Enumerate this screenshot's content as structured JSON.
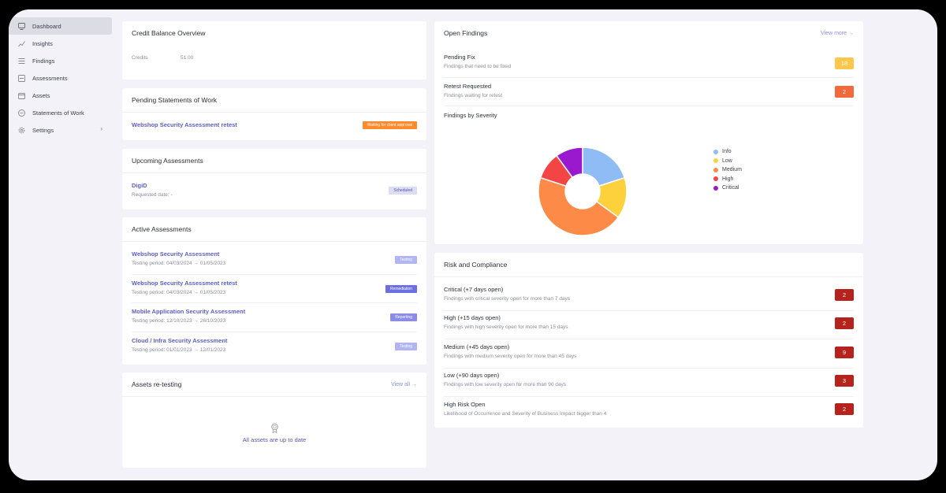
{
  "sidebar": {
    "items": [
      {
        "label": "Dashboard",
        "icon": "dashboard-icon"
      },
      {
        "label": "Insights",
        "icon": "chart-icon"
      },
      {
        "label": "Findings",
        "icon": "list-icon"
      },
      {
        "label": "Assessments",
        "icon": "assessment-icon"
      },
      {
        "label": "Assets",
        "icon": "folder-icon"
      },
      {
        "label": "Statements of Work",
        "icon": "document-icon"
      },
      {
        "label": "Settings",
        "icon": "gear-icon"
      }
    ],
    "settings_chevron": "›"
  },
  "credit": {
    "title": "Credit Balance Overview",
    "label": "Credits",
    "value": "51.00"
  },
  "pending_sow": {
    "title": "Pending Statements of Work",
    "item_title": "Webshop Security Assessment retest",
    "badge": "Waiting for client approval"
  },
  "upcoming": {
    "title": "Upcoming Assessments",
    "item_title": "DigiD",
    "item_sub": "Requested date: -",
    "badge": "Scheduled"
  },
  "active": {
    "title": "Active Assessments",
    "items": [
      {
        "title": "Webshop Security Assessment",
        "period": "Testing period: 04/03/2024 → 01/05/2023",
        "badge": "Testing"
      },
      {
        "title": "Webshop Security Assessment retest",
        "period": "Testing period: 04/03/2024 → 01/05/2023",
        "badge": "Remediation"
      },
      {
        "title": "Mobile Application Security Assessment",
        "period": "Testing period: 12/10/2023 → 26/10/2023",
        "badge": "Reporting"
      },
      {
        "title": "Cloud / Infra Security Assessment",
        "period": "Testing period: 01/01/2023 → 12/01/2023",
        "badge": "Testing"
      }
    ]
  },
  "retesting": {
    "title": "Assets re-testing",
    "link": "View all →",
    "empty": "All assets are up to date"
  },
  "open_findings": {
    "title": "Open Findings",
    "link": "View more →",
    "pending_title": "Pending Fix",
    "pending_sub": "Findings that need to be fixed",
    "pending_count": "18",
    "retest_title": "Retest Requested",
    "retest_sub": "Findings waiting for retest",
    "retest_count": "2",
    "severity_title": "Findings by Severity"
  },
  "chart_data": {
    "type": "pie",
    "donut": true,
    "categories": [
      "Info",
      "Low",
      "Medium",
      "High",
      "Critical"
    ],
    "values": [
      4,
      3,
      9,
      2,
      2
    ],
    "colors": [
      "#8fbcf5",
      "#fdd13b",
      "#fd8a46",
      "#f44545",
      "#9a19cf"
    ],
    "legend": "right"
  },
  "risk": {
    "title": "Risk and Compliance",
    "items": [
      {
        "title": "Critical (+7 days open)",
        "sub": "Findings with critical severity open for more than 7 days",
        "count": "2"
      },
      {
        "title": "High (+15 days open)",
        "sub": "Findings with high severity open for more than 15 days",
        "count": "2"
      },
      {
        "title": "Medium (+45 days open)",
        "sub": "Findings with medium severity open for more than 45 days",
        "count": "9"
      },
      {
        "title": "Low (+90 days open)",
        "sub": "Findings with low severity open for more than 90 days",
        "count": "3"
      },
      {
        "title": "High Risk Open",
        "sub": "Likelihood of Occurrence and Severity of Business Impact bigger than 4",
        "count": "2"
      }
    ]
  },
  "colors": {
    "accent": "#5c5fc8",
    "orange": "#fd8a2b",
    "count_red": "#b5231c",
    "count_yellow": "#fcc74b",
    "count_orange": "#f26a3b"
  }
}
